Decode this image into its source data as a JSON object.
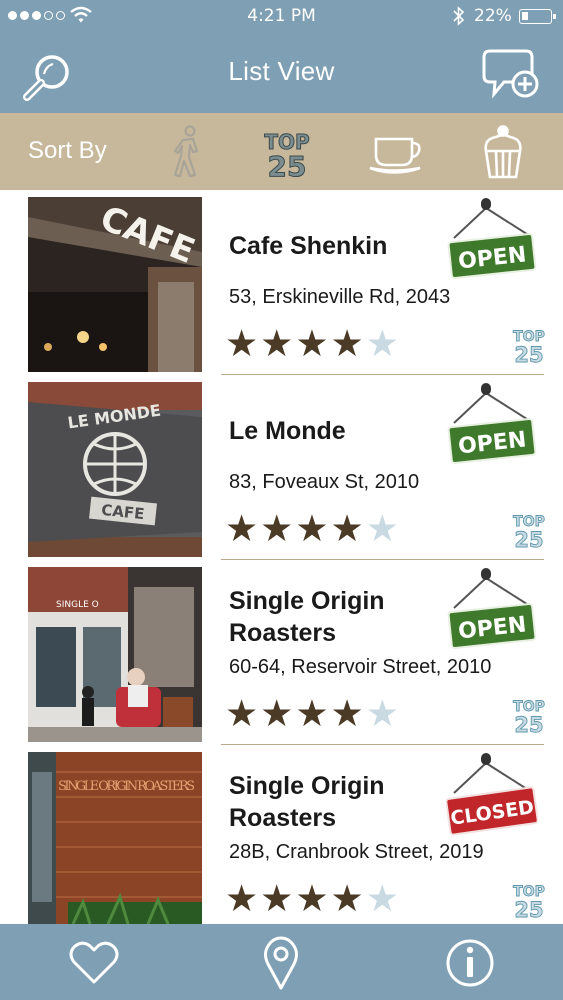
{
  "status_bar": {
    "time": "4:21 PM",
    "battery_pct": "22%",
    "battery_level": 0.22,
    "signal_dots_filled": 3,
    "signal_dots_total": 5
  },
  "nav": {
    "title": "List View",
    "left_icon": "search-icon",
    "right_icon": "chat-add-icon"
  },
  "sort": {
    "label": "Sort By",
    "options": [
      {
        "icon": "walking-person-icon",
        "name": "Distance"
      },
      {
        "icon": "top25-icon",
        "text_top": "TOP",
        "text_bottom": "25"
      },
      {
        "icon": "coffee-cup-icon"
      },
      {
        "icon": "cupcake-icon"
      }
    ]
  },
  "cafes": [
    {
      "name": "Cafe Shenkin",
      "address": "53, Erskineville Rd, 2043",
      "rating": 4,
      "max_rating": 5,
      "status": "OPEN",
      "top25": "TOP 25"
    },
    {
      "name": "Le Monde",
      "address": "83, Foveaux St, 2010",
      "rating": 4,
      "max_rating": 5,
      "status": "OPEN",
      "top25": "TOP 25"
    },
    {
      "name": "Single Origin Roasters",
      "address": "60-64, Reservoir Street, 2010",
      "rating": 4,
      "max_rating": 5,
      "status": "OPEN",
      "top25": "TOP 25"
    },
    {
      "name": "Single Origin Roasters",
      "address": "28B, Cranbrook Street, 2019",
      "rating": 4,
      "max_rating": 5,
      "status": "CLOSED",
      "top25": "TOP 25"
    }
  ],
  "photo_text": {
    "shenkin": "CAFE S",
    "lemonde_top": "LE MONDE",
    "lemonde_bottom": "CAFE",
    "reservoir_sign": "SINGLE O",
    "cranbrook_wall": "SINGLE ORIGIN ROASTERS"
  },
  "colors": {
    "header": "#7fa0b4",
    "sortbar": "#c8b89b",
    "star_on": "#4a3a26",
    "star_off": "#c9dae2",
    "open": "#3f7a2c",
    "closed": "#c0262a"
  },
  "tabs": [
    {
      "icon": "heart-icon",
      "name": "favourites"
    },
    {
      "icon": "map-pin-icon",
      "name": "map"
    },
    {
      "icon": "info-icon",
      "name": "info"
    }
  ]
}
